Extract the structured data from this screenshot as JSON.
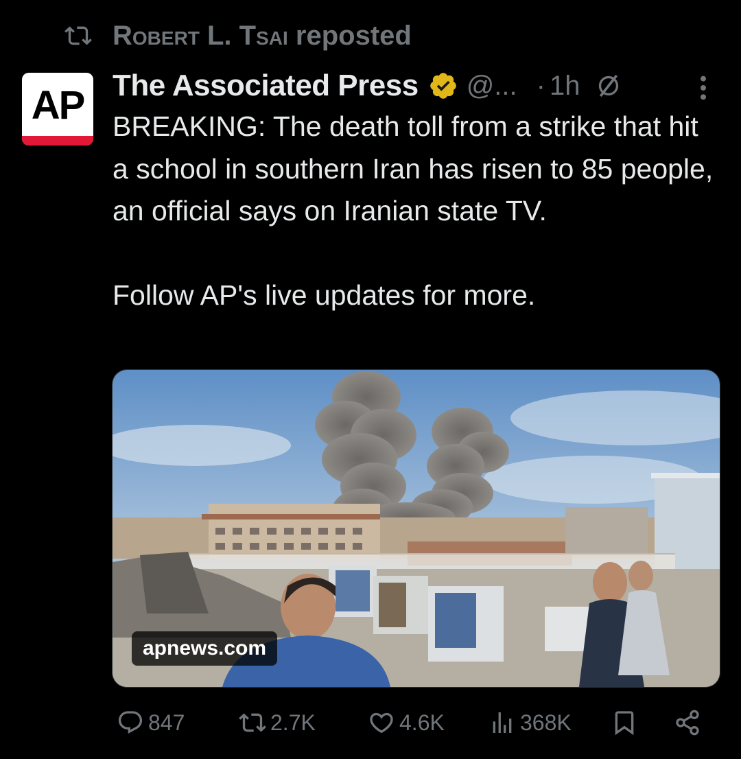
{
  "repost_header": {
    "reposter": "Robert L. Tsai",
    "label": "reposted"
  },
  "author": {
    "avatar_text": "AP",
    "display_name": "The Associated Press",
    "handle": "@...",
    "separator": "·",
    "timestamp": "1h"
  },
  "tweet": {
    "text": "BREAKING: The death toll from a strike that hit a school in southern Iran has risen to 85 people, an official says on Iranian state TV.\n\nFollow AP's live updates for more."
  },
  "media": {
    "domain": "apnews.com"
  },
  "actions": {
    "replies": "847",
    "reposts": "2.7K",
    "likes": "4.6K",
    "views": "368K"
  },
  "colors": {
    "background": "#000000",
    "text": "#e7e9ea",
    "muted": "#71767b",
    "verified_gold": "#e2b719",
    "ap_red": "#e31837"
  },
  "icons": [
    "repost-icon",
    "verified-badge-icon",
    "mute-icon",
    "more-icon",
    "reply-icon",
    "repost-icon",
    "like-icon",
    "views-icon",
    "bookmark-icon",
    "share-icon"
  ]
}
